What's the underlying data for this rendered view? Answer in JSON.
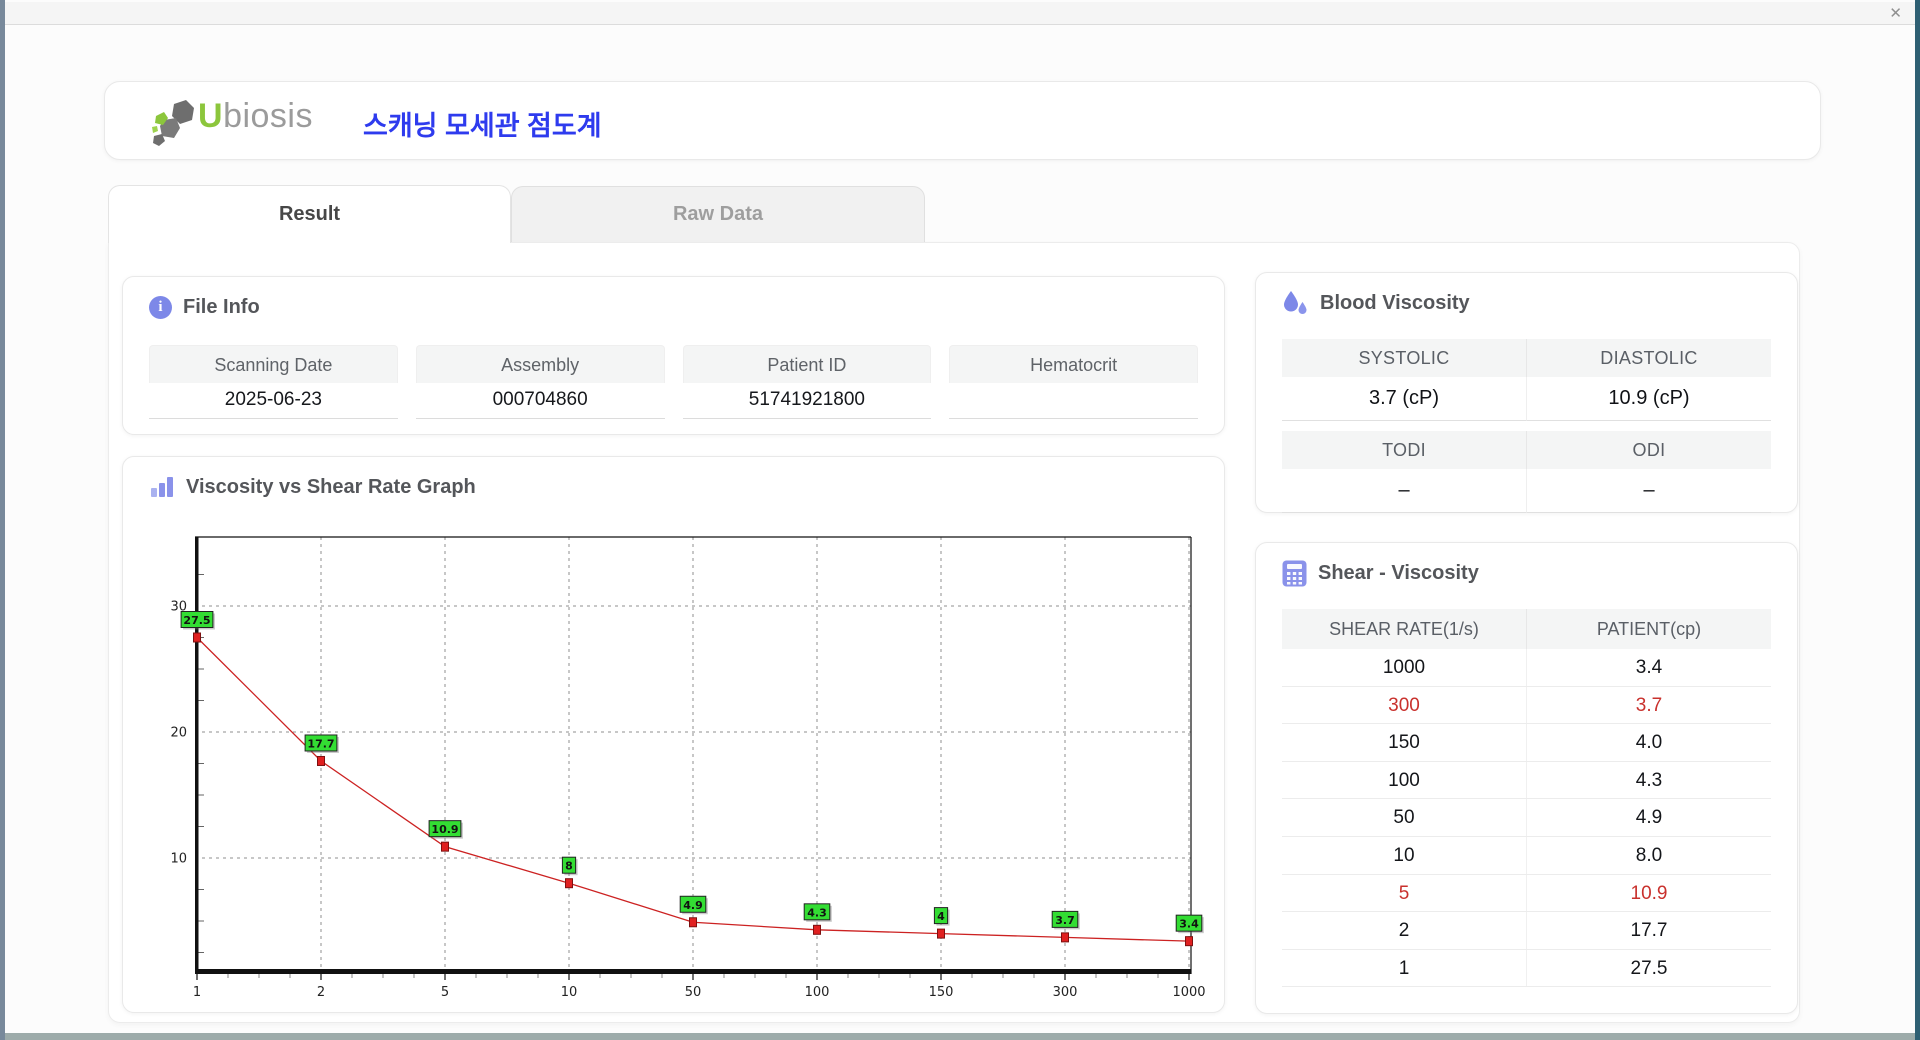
{
  "window": {
    "close_label": "✕"
  },
  "header": {
    "logo_u": "U",
    "logo_rest": "biosis",
    "app_title": "스캐닝 모세관 점도계"
  },
  "tabs": {
    "result": "Result",
    "raw": "Raw Data"
  },
  "file_info": {
    "title": "File Info",
    "fields": [
      {
        "label": "Scanning Date",
        "value": "2025-06-23"
      },
      {
        "label": "Assembly",
        "value": "000704860"
      },
      {
        "label": "Patient ID",
        "value": "51741921800"
      },
      {
        "label": "Hematocrit",
        "value": ""
      }
    ]
  },
  "blood_viscosity": {
    "title": "Blood Viscosity",
    "groups": [
      {
        "labels": [
          "SYSTOLIC",
          "DIASTOLIC"
        ],
        "values": [
          "3.7 (cP)",
          "10.9 (cP)"
        ]
      },
      {
        "labels": [
          "TODI",
          "ODI"
        ],
        "values": [
          "–",
          "–"
        ]
      }
    ]
  },
  "shear_viscosity": {
    "title": "Shear - Viscosity",
    "columns": [
      "SHEAR RATE(1/s)",
      "PATIENT(cp)"
    ],
    "rows": [
      {
        "shear_rate": "1000",
        "patient": "3.4",
        "highlight": false
      },
      {
        "shear_rate": "300",
        "patient": "3.7",
        "highlight": true
      },
      {
        "shear_rate": "150",
        "patient": "4.0",
        "highlight": false
      },
      {
        "shear_rate": "100",
        "patient": "4.3",
        "highlight": false
      },
      {
        "shear_rate": "50",
        "patient": "4.9",
        "highlight": false
      },
      {
        "shear_rate": "10",
        "patient": "8.0",
        "highlight": false
      },
      {
        "shear_rate": "5",
        "patient": "10.9",
        "highlight": true
      },
      {
        "shear_rate": "2",
        "patient": "17.7",
        "highlight": false
      },
      {
        "shear_rate": "1",
        "patient": "27.5",
        "highlight": false
      }
    ]
  },
  "chart_data": {
    "type": "line",
    "title": "Viscosity vs Shear Rate Graph",
    "x": [
      1,
      2,
      5,
      10,
      50,
      100,
      150,
      300,
      1000
    ],
    "y": [
      27.5,
      17.7,
      10.9,
      8.0,
      4.9,
      4.3,
      4.0,
      3.7,
      3.4
    ],
    "point_labels": [
      "27.5",
      "17.7",
      "10.9",
      "8",
      "4.9",
      "4.3",
      "4",
      "3.7",
      "3.4"
    ],
    "x_tick_labels": [
      "1",
      "2",
      "5",
      "10",
      "50",
      "100",
      "150",
      "300",
      "1000"
    ],
    "y_ticks": [
      10,
      20,
      30
    ],
    "ylim": [
      0.9,
      35.5
    ],
    "grid": true,
    "legend": false,
    "line_color": "#cc2222",
    "marker_color": "#e02020",
    "label_bg": "#33dd33"
  },
  "colors": {
    "accent": "#7d88e8",
    "highlight_red": "#c9312d"
  }
}
